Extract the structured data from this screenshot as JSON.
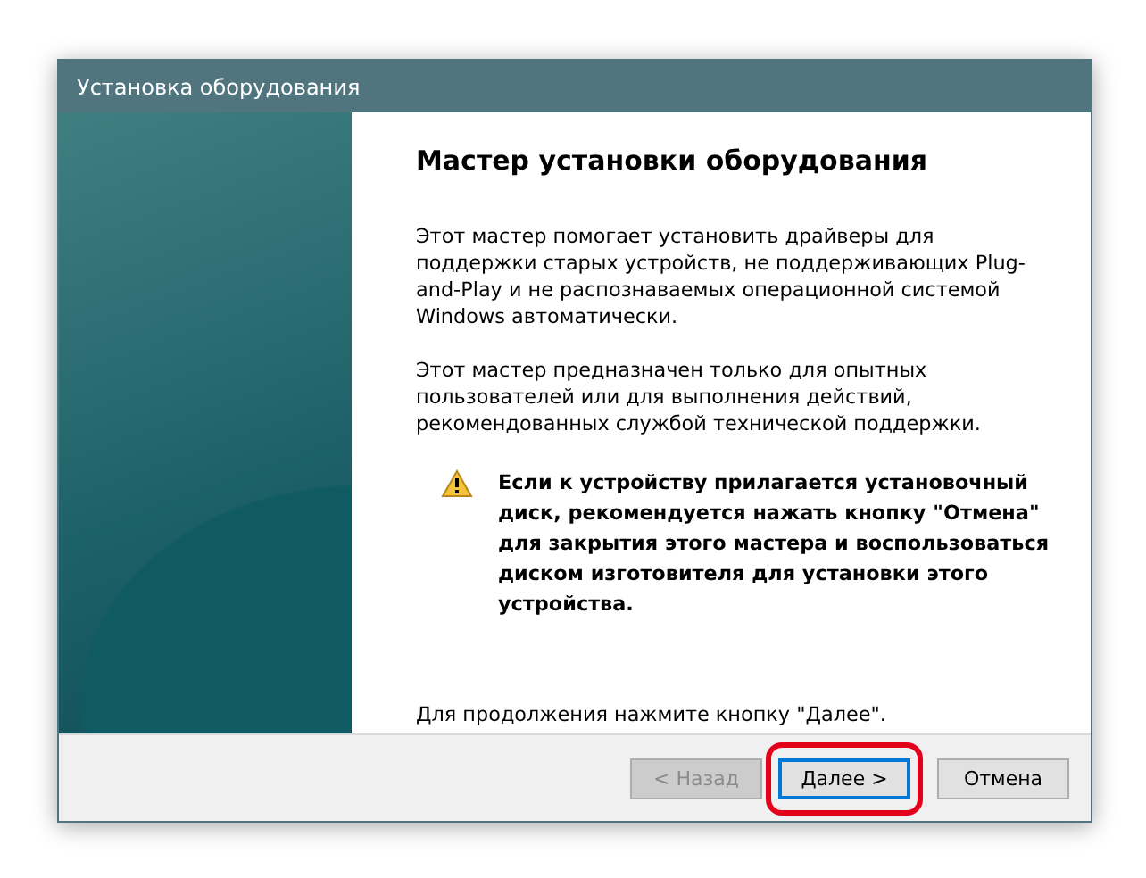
{
  "window": {
    "title": "Установка оборудования"
  },
  "heading": "Мастер установки оборудования",
  "paragraphs": [
    "Этот мастер помогает установить драйверы для поддержки старых устройств, не поддерживающих Plug-and-Play и не распознаваемых операционной системой Windows автоматически.",
    "Этот мастер предназначен только для опытных пользователей или для выполнения действий, рекомендованных службой технической поддержки."
  ],
  "warning": "Если к устройству прилагается установочный диск, рекомендуется нажать кнопку \"Отмена\" для закрытия этого мастера и воспользоваться диском изготовителя для установки этого устройства.",
  "footer_text": "Для продолжения нажмите кнопку \"Далее\".",
  "buttons": [
    {
      "label": "< Назад",
      "disabled": true,
      "default": false,
      "highlighted": false
    },
    {
      "label": "Далее >",
      "disabled": false,
      "default": true,
      "highlighted": true
    },
    {
      "label": "Отмена",
      "disabled": false,
      "default": false,
      "highlighted": false
    }
  ]
}
